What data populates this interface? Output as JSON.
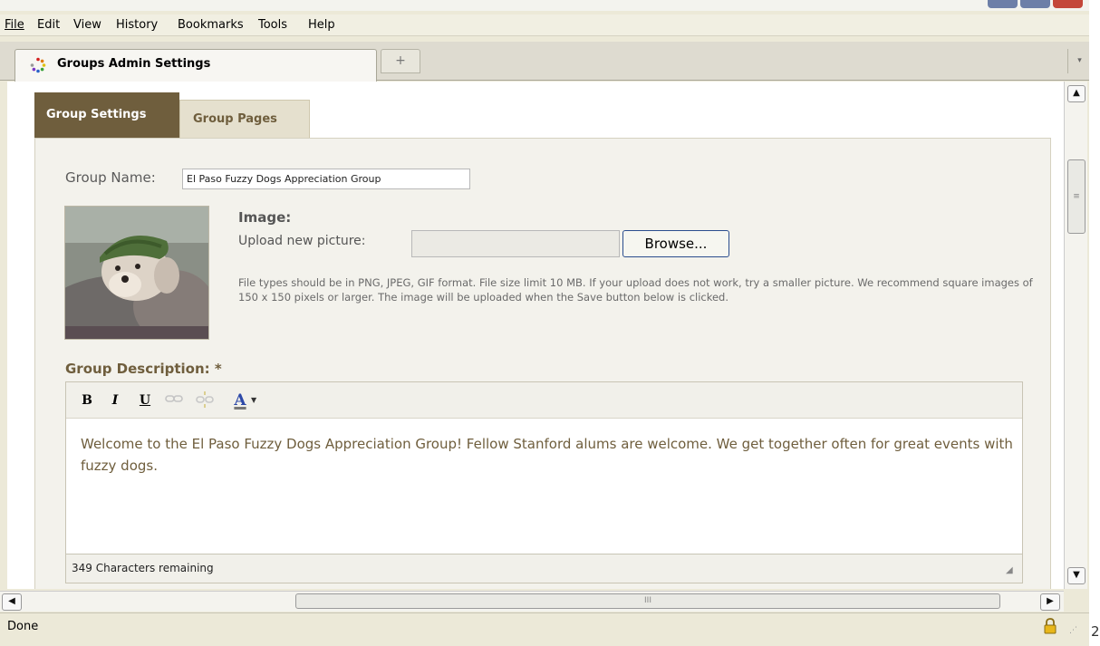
{
  "menubar": {
    "items": [
      {
        "label": "File"
      },
      {
        "label": "Edit"
      },
      {
        "label": "View"
      },
      {
        "label": "History"
      },
      {
        "label": "Bookmarks"
      },
      {
        "label": "Tools"
      },
      {
        "label": "Help"
      }
    ]
  },
  "browser_tab": {
    "title": "Groups Admin Settings",
    "icon": "loading-spinner-icon",
    "new_tab_symbol": "+"
  },
  "status": {
    "text": "Done",
    "lock_icon": "padlock-icon"
  },
  "edge_fragment": "2",
  "page": {
    "tabs": [
      {
        "label": "Group Settings",
        "active": true
      },
      {
        "label": "Group Pages",
        "active": false
      }
    ],
    "group_name_label": "Group Name:",
    "group_name_value": "El Paso Fuzzy Dogs Appreciation Group",
    "image_heading": "Image:",
    "upload_label": "Upload new picture:",
    "file_input_value": "",
    "browse_button": "Browse...",
    "help_text": "File types should be in PNG, JPEG, GIF format. File size limit 10 MB. If your upload does not work, try a smaller picture. We recommend square images of 150 x 150 pixels or larger. The image will be uploaded when the Save button below is clicked.",
    "description_label": "Group Description:",
    "description_required": "*",
    "description_text": "Welcome to the El Paso Fuzzy Dogs Appreciation Group! Fellow Stanford alums are welcome. We get together often for great events with fuzzy dogs.",
    "chars_remaining": "349 Characters remaining",
    "toolbar": {
      "bold": "B",
      "italic": "I",
      "underline": "U",
      "link_icon": "link-icon",
      "unlink_icon": "unlink-icon",
      "text_color": "A"
    }
  },
  "colors": {
    "accent_brown": "#6f5e3d",
    "tab_inactive": "#e5e0ce",
    "panel_bg": "#f3f2ec",
    "chrome_bg": "#ece9d8"
  }
}
